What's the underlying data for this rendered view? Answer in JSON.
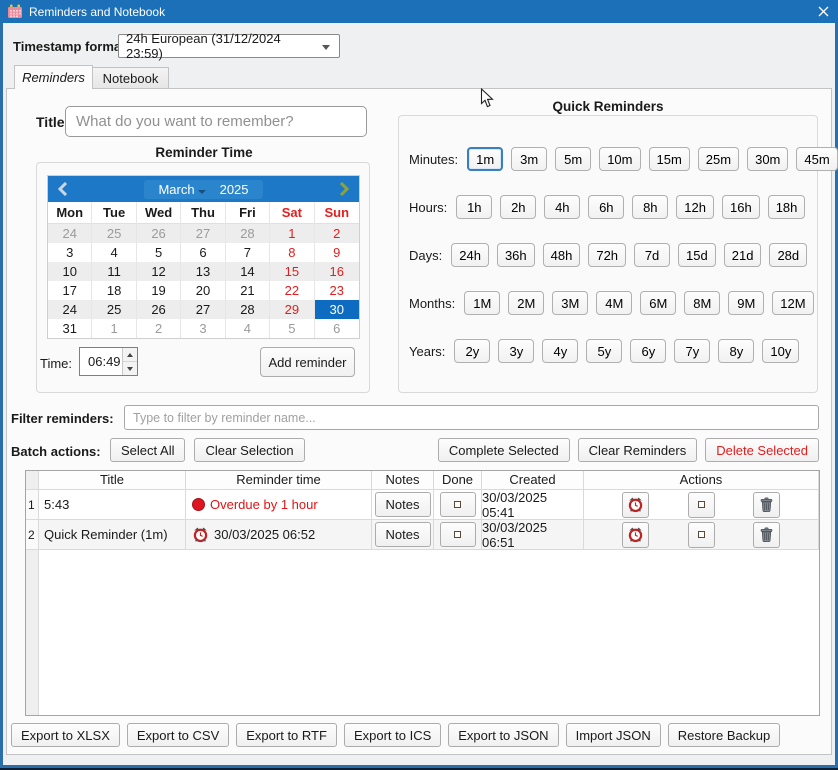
{
  "window": {
    "title": "Reminders and Notebook"
  },
  "timestamp": {
    "label": "Timestamp format:",
    "value": "24h European (31/12/2024 23:59)"
  },
  "tabs": [
    {
      "label": "Reminders"
    },
    {
      "label": "Notebook"
    }
  ],
  "reminder_form": {
    "title_label": "Title:",
    "title_placeholder": "What do you want to remember?",
    "section_title": "Reminder Time",
    "calendar": {
      "month": "March",
      "year": "2025",
      "day_headers": [
        "Mon",
        "Tue",
        "Wed",
        "Thu",
        "Fri",
        "Sat",
        "Sun"
      ],
      "weeks": [
        [
          {
            "d": "24",
            "t": "muted"
          },
          {
            "d": "25",
            "t": "muted"
          },
          {
            "d": "26",
            "t": "muted"
          },
          {
            "d": "27",
            "t": "muted"
          },
          {
            "d": "28",
            "t": "muted"
          },
          {
            "d": "1",
            "t": "weekend"
          },
          {
            "d": "2",
            "t": "weekend"
          }
        ],
        [
          {
            "d": "3",
            "t": "normal"
          },
          {
            "d": "4",
            "t": "normal"
          },
          {
            "d": "5",
            "t": "normal"
          },
          {
            "d": "6",
            "t": "normal"
          },
          {
            "d": "7",
            "t": "normal"
          },
          {
            "d": "8",
            "t": "weekend"
          },
          {
            "d": "9",
            "t": "weekend"
          }
        ],
        [
          {
            "d": "10",
            "t": "normal"
          },
          {
            "d": "11",
            "t": "normal"
          },
          {
            "d": "12",
            "t": "normal"
          },
          {
            "d": "13",
            "t": "normal"
          },
          {
            "d": "14",
            "t": "normal"
          },
          {
            "d": "15",
            "t": "weekend"
          },
          {
            "d": "16",
            "t": "weekend"
          }
        ],
        [
          {
            "d": "17",
            "t": "normal"
          },
          {
            "d": "18",
            "t": "normal"
          },
          {
            "d": "19",
            "t": "normal"
          },
          {
            "d": "20",
            "t": "normal"
          },
          {
            "d": "21",
            "t": "normal"
          },
          {
            "d": "22",
            "t": "weekend"
          },
          {
            "d": "23",
            "t": "weekend"
          }
        ],
        [
          {
            "d": "24",
            "t": "normal"
          },
          {
            "d": "25",
            "t": "normal"
          },
          {
            "d": "26",
            "t": "normal"
          },
          {
            "d": "27",
            "t": "normal"
          },
          {
            "d": "28",
            "t": "normal"
          },
          {
            "d": "29",
            "t": "weekend"
          },
          {
            "d": "30",
            "t": "selected"
          }
        ],
        [
          {
            "d": "31",
            "t": "normal"
          },
          {
            "d": "1",
            "t": "muted"
          },
          {
            "d": "2",
            "t": "muted"
          },
          {
            "d": "3",
            "t": "muted"
          },
          {
            "d": "4",
            "t": "muted"
          },
          {
            "d": "5",
            "t": "muted"
          },
          {
            "d": "6",
            "t": "muted"
          }
        ]
      ]
    },
    "time_label": "Time:",
    "time_value": "06:49",
    "add_button": "Add reminder"
  },
  "quick": {
    "title": "Quick Reminders",
    "rows": [
      {
        "label": "Minutes:",
        "buttons": [
          "1m",
          "3m",
          "5m",
          "10m",
          "15m",
          "25m",
          "30m",
          "45m"
        ],
        "focused": 0
      },
      {
        "label": "Hours:",
        "buttons": [
          "1h",
          "2h",
          "4h",
          "6h",
          "8h",
          "12h",
          "16h",
          "18h"
        ]
      },
      {
        "label": "Days:",
        "buttons": [
          "24h",
          "36h",
          "48h",
          "72h",
          "7d",
          "15d",
          "21d",
          "28d"
        ]
      },
      {
        "label": "Months:",
        "buttons": [
          "1M",
          "2M",
          "3M",
          "4M",
          "6M",
          "8M",
          "9M",
          "12M"
        ]
      },
      {
        "label": "Years:",
        "buttons": [
          "2y",
          "3y",
          "4y",
          "5y",
          "6y",
          "7y",
          "8y",
          "10y"
        ]
      }
    ]
  },
  "filter": {
    "label": "Filter reminders:",
    "placeholder": "Type to filter by reminder name..."
  },
  "batch": {
    "label": "Batch actions:",
    "left_buttons": [
      "Select All",
      "Clear Selection"
    ],
    "right_buttons": [
      "Complete Selected",
      "Clear Reminders",
      "Delete Selected"
    ]
  },
  "table": {
    "headers": [
      "Title",
      "Reminder time",
      "Notes",
      "Done",
      "Created",
      "Actions"
    ],
    "action_icons": [
      "alarm-clock",
      "done-checkbox",
      "trash"
    ],
    "rows": [
      {
        "num": "1",
        "title": "5:43",
        "time": "Overdue by 1 hour",
        "overdue": true,
        "notes": "Notes",
        "created": "30/03/2025 05:41"
      },
      {
        "num": "2",
        "title": "Quick Reminder (1m)",
        "time": "30/03/2025 06:52",
        "overdue": false,
        "notes": "Notes",
        "created": "30/03/2025 06:51"
      }
    ]
  },
  "footer": {
    "buttons": [
      "Export to XLSX",
      "Export to CSV",
      "Export to RTF",
      "Export to ICS",
      "Export to JSON",
      "Import JSON",
      "Restore Backup"
    ]
  },
  "colors": {
    "titlebar": "#1c70b8",
    "calendar_header": "#1d79c7",
    "selected_day": "#0d6cc1",
    "overdue_red": "#e01515",
    "weekend_red": "#e02020",
    "danger_red": "#dd2020"
  }
}
